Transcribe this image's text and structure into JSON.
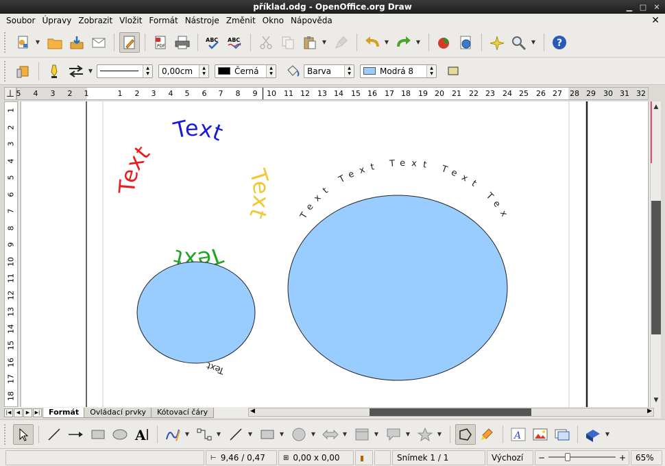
{
  "window": {
    "title": "příklad.odg - OpenOffice.org Draw"
  },
  "menu": [
    "Soubor",
    "Úpravy",
    "Zobrazit",
    "Vložit",
    "Formát",
    "Nástroje",
    "Změnit",
    "Okno",
    "Nápověda"
  ],
  "line_toolbar": {
    "line_width": "0,00cm",
    "line_color": "Černá",
    "line_color_hex": "#000000",
    "area_style": "Barva",
    "area_color": "Modrá 8",
    "area_color_hex": "#99ccff"
  },
  "ruler": {
    "h_ticks": [
      "5",
      "4",
      "3",
      "2",
      "1",
      "1",
      "2",
      "3",
      "4",
      "5",
      "6",
      "7",
      "8",
      "9",
      "10",
      "11",
      "12",
      "13",
      "14",
      "15",
      "16",
      "17",
      "18",
      "19",
      "20",
      "21",
      "22",
      "23",
      "24",
      "25",
      "26",
      "27",
      "28",
      "29",
      "30",
      "31",
      "32"
    ],
    "v_ticks": [
      "1",
      "2",
      "3",
      "4",
      "5",
      "6",
      "7",
      "8",
      "9",
      "10",
      "11",
      "12",
      "13",
      "14",
      "15",
      "16",
      "17",
      "18"
    ]
  },
  "drawing": {
    "text_red": "Text",
    "text_blue": "Text",
    "text_yellow": "Text",
    "text_green": "Text",
    "text_small_circle": "Text",
    "text_large_circle": "Text Text Text Text Tex",
    "colors": {
      "red": "#e81e1e",
      "blue": "#1a1ad6",
      "yellow": "#f0c832",
      "green": "#23a323",
      "fill": "#99ccff"
    }
  },
  "tabs": [
    "Formát",
    "Ovládací prvky",
    "Kótovací čáry"
  ],
  "status": {
    "position": "9,46 / 0,47",
    "size": "0,00 x 0,00",
    "slide": "Snímek 1 / 1",
    "layout": "Výchozí",
    "zoom": "65%",
    "zoom_minus": "−",
    "zoom_plus": "+"
  },
  "icons": {
    "help": "?"
  }
}
